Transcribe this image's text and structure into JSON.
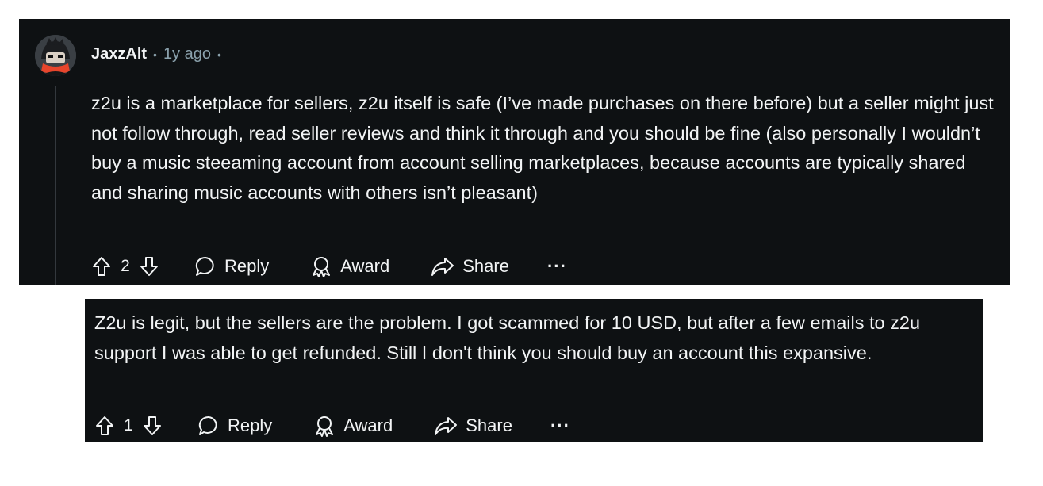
{
  "comments": [
    {
      "username": "JaxzAlt",
      "time": "1y ago",
      "body": "z2u is a marketplace for sellers, z2u itself is safe (I’ve made purchases on there before) but a seller might just not follow through, read seller reviews and think it through and you should be fine (also personally I wouldn’t buy a music steeaming account from account selling marketplaces, because accounts are typically shared and sharing music accounts with others isn’t pleasant)",
      "votes": "2",
      "actions": {
        "reply": "Reply",
        "award": "Award",
        "share": "Share",
        "more": "···"
      }
    },
    {
      "body": "Z2u is legit, but the sellers are the problem. I got scammed for 10 USD, but after a few emails to z2u support I was able to get refunded. Still I don't think you should buy an account this expansive.",
      "votes": "1",
      "actions": {
        "reply": "Reply",
        "award": "Award",
        "share": "Share",
        "more": "···"
      }
    }
  ],
  "colors": {
    "background": "#0e1113",
    "text": "#f2f4f5",
    "muted": "#8ba2ad",
    "avatar_accent": "#e8452c"
  },
  "icons": [
    "upvote-icon",
    "downvote-icon",
    "comment-bubble-icon",
    "award-icon",
    "share-arrow-icon",
    "more-dots-icon"
  ]
}
